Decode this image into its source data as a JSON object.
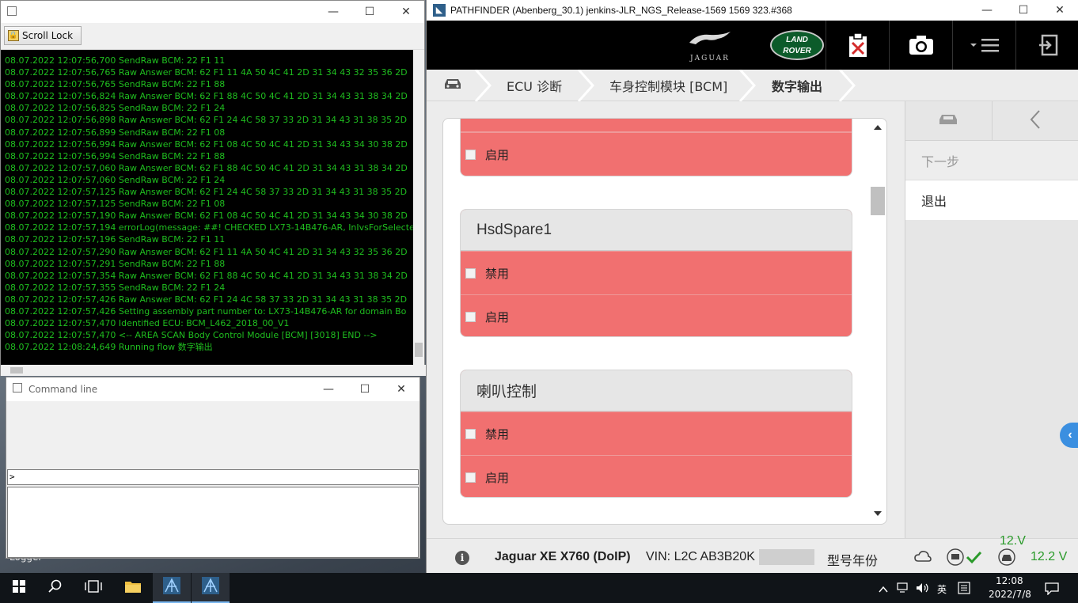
{
  "logger": {
    "scroll_lock_label": "Scroll Lock",
    "controls": {
      "minimize": "—",
      "maximize": "☐",
      "close": "✕"
    },
    "lines": [
      "08.07.2022 12:07:56,700 SendRaw BCM: 22 F1 11",
      "08.07.2022 12:07:56,765 Raw Answer BCM: 62 F1 11 4A 50 4C 41 2D 31 34 43 32 35 36 2D",
      "08.07.2022 12:07:56,765 SendRaw BCM: 22 F1 88",
      "08.07.2022 12:07:56,824 Raw Answer BCM: 62 F1 88 4C 50 4C 41 2D 31 34 43 31 38 34 2D",
      "08.07.2022 12:07:56,825 SendRaw BCM: 22 F1 24",
      "08.07.2022 12:07:56,898 Raw Answer BCM: 62 F1 24 4C 58 37 33 2D 31 34 43 31 38 35 2D",
      "08.07.2022 12:07:56,899 SendRaw BCM: 22 F1 08",
      "08.07.2022 12:07:56,994 Raw Answer BCM: 62 F1 08 4C 50 4C 41 2D 31 34 43 34 30 38 2D",
      "08.07.2022 12:07:56,994 SendRaw BCM: 22 F1 88",
      "08.07.2022 12:07:57,060 Raw Answer BCM: 62 F1 88 4C 50 4C 41 2D 31 34 43 31 38 34 2D",
      "08.07.2022 12:07:57,060 SendRaw BCM: 22 F1 24",
      "08.07.2022 12:07:57,125 Raw Answer BCM: 62 F1 24 4C 58 37 33 2D 31 34 43 31 38 35 2D",
      "08.07.2022 12:07:57,125 SendRaw BCM: 22 F1 08",
      "08.07.2022 12:07:57,190 Raw Answer BCM: 62 F1 08 4C 50 4C 41 2D 31 34 43 34 30 38 2D",
      "08.07.2022 12:07:57,194 errorLog(message: ##! CHECKED LX73-14B476-AR, InIvsForSelecte",
      "08.07.2022 12:07:57,196 SendRaw BCM: 22 F1 11",
      "08.07.2022 12:07:57,290 Raw Answer BCM: 62 F1 11 4A 50 4C 41 2D 31 34 43 32 35 36 2D",
      "08.07.2022 12:07:57,291 SendRaw BCM: 22 F1 88",
      "08.07.2022 12:07:57,354 Raw Answer BCM: 62 F1 88 4C 50 4C 41 2D 31 34 43 31 38 34 2D",
      "08.07.2022 12:07:57,355 SendRaw BCM: 22 F1 24",
      "08.07.2022 12:07:57,426 Raw Answer BCM: 62 F1 24 4C 58 37 33 2D 31 34 43 31 38 35 2D",
      "08.07.2022 12:07:57,426 Setting assembly part number to: LX73-14B476-AR for domain Bo",
      "08.07.2022 12:07:57,470 Identified ECU: BCM_L462_2018_00_V1",
      "08.07.2022 12:07:57,470 <-- AREA SCAN Body Control Module [BCM] [3018] END -->",
      "08.07.2022 12:08:24,649 Running flow 数字输出"
    ]
  },
  "cmd": {
    "title": "Command line",
    "prompt": ">"
  },
  "desktop": {
    "logger_label": "Logger"
  },
  "pathfinder": {
    "title": "PATHFINDER (Abenberg_30.1) jenkins-JLR_NGS_Release-1569 1569 323.#368",
    "brand_jaguar": "JAGUAR",
    "brand_landrover_1": "LAND",
    "brand_landrover_2": "ROVER",
    "breadcrumbs": [
      "ECU 诊断",
      "车身控制模块 [BCM]",
      "数字输出"
    ],
    "cards": [
      {
        "title": "",
        "options": [
          "启用"
        ]
      },
      {
        "title": "HsdSpare1",
        "options": [
          "禁用",
          "启用"
        ]
      },
      {
        "title": "喇叭控制",
        "options": [
          "禁用",
          "启用"
        ]
      }
    ],
    "right_panel": {
      "next": "下一步",
      "exit": "退出"
    },
    "status": {
      "vehicle": "Jaguar XE X760 (DoIP)",
      "vin": "VIN: L2C AB3B20K",
      "model_year": "型号年份",
      "voltage_top": "12.V",
      "voltage": "12.2 V"
    }
  },
  "taskbar": {
    "ime": "英",
    "time": "12:08",
    "date": "2022/7/8"
  },
  "colors": {
    "log_green": "#1fbd1f",
    "option_red": "#f17070",
    "voltage_green": "#2a9a2a",
    "header_black": "#000000"
  }
}
